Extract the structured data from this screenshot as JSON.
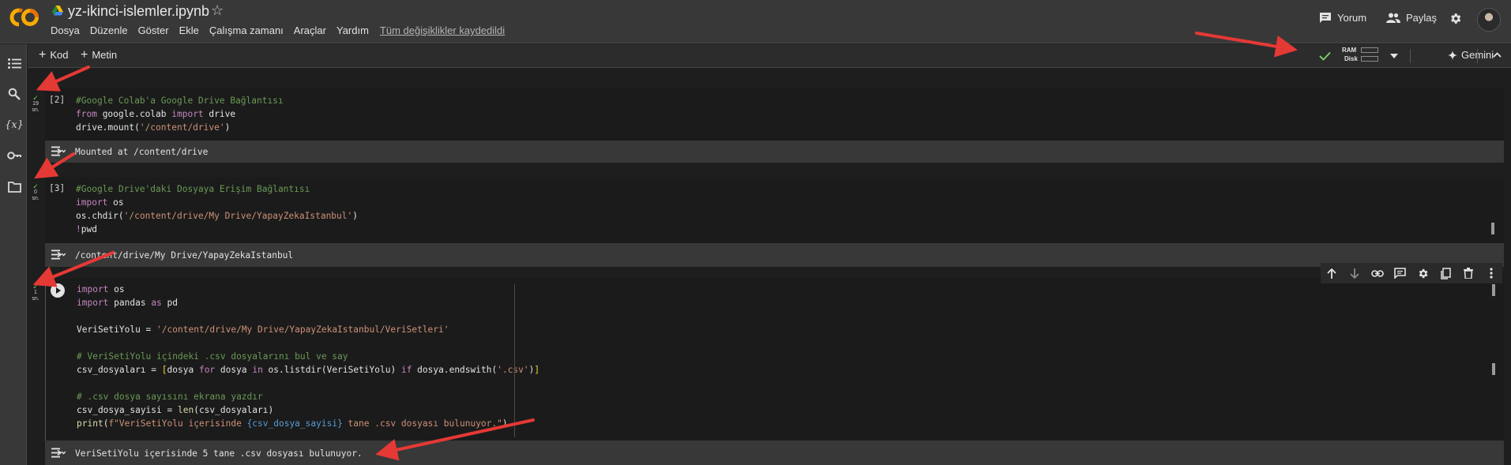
{
  "header": {
    "title": "yz-ikinci-islemler.ipynb",
    "menu": [
      "Dosya",
      "Düzenle",
      "Göster",
      "Ekle",
      "Çalışma zamanı",
      "Araçlar",
      "Yardım"
    ],
    "saved_status": "Tüm değişiklikler kaydedildi",
    "comment_label": "Yorum",
    "share_label": "Paylaş"
  },
  "toolbar": {
    "add_code": "Kod",
    "add_text": "Metin",
    "ram_label": "RAM",
    "disk_label": "Disk",
    "gemini_label": "Gemini"
  },
  "cells": [
    {
      "exec": "[2]",
      "status": {
        "time": "19",
        "unit": "sn."
      },
      "lines": [
        [
          {
            "c": "c-com",
            "t": "#Google Colab'a Google Drive Bağlantısı"
          }
        ],
        [
          {
            "c": "c-kw",
            "t": "from"
          },
          {
            "c": "c-def",
            "t": " google.colab "
          },
          {
            "c": "c-kw",
            "t": "import"
          },
          {
            "c": "c-def",
            "t": " drive"
          }
        ],
        [
          {
            "c": "c-def",
            "t": "drive.mount("
          },
          {
            "c": "c-str",
            "t": "'/content/drive'"
          },
          {
            "c": "c-def",
            "t": ")"
          }
        ]
      ],
      "output": "Mounted at /content/drive"
    },
    {
      "exec": "[3]",
      "status": {
        "time": "0",
        "unit": "sn."
      },
      "lines": [
        [
          {
            "c": "c-com",
            "t": "#Google Drive'daki Dosyaya Erişim Bağlantısı"
          }
        ],
        [
          {
            "c": "c-kw",
            "t": "import"
          },
          {
            "c": "c-def",
            "t": " os"
          }
        ],
        [
          {
            "c": "c-def",
            "t": "os.chdir("
          },
          {
            "c": "c-str",
            "t": "'/content/drive/My Drive/YapayZekaIstanbul'"
          },
          {
            "c": "c-def",
            "t": ")"
          }
        ],
        [
          {
            "c": "c-kw",
            "t": "!"
          },
          {
            "c": "c-def",
            "t": "pwd"
          }
        ]
      ],
      "output": "/content/drive/My Drive/YapayZekaIstanbul"
    },
    {
      "exec": "",
      "status": {
        "time": "1",
        "unit": "sn."
      },
      "lines": [
        [
          {
            "c": "c-kw",
            "t": "import"
          },
          {
            "c": "c-def",
            "t": " os"
          }
        ],
        [
          {
            "c": "c-kw",
            "t": "import"
          },
          {
            "c": "c-def",
            "t": " pandas "
          },
          {
            "c": "c-kw",
            "t": "as"
          },
          {
            "c": "c-def",
            "t": " pd"
          }
        ],
        [],
        [
          {
            "c": "c-def",
            "t": "VeriSetiYolu = "
          },
          {
            "c": "c-str",
            "t": "'/content/drive/My Drive/YapayZekaIstanbul/VeriSetleri'"
          }
        ],
        [],
        [
          {
            "c": "c-com",
            "t": "# VeriSetiYolu içindeki .csv dosyalarını bul ve say"
          }
        ],
        [
          {
            "c": "c-def",
            "t": "csv_dosyaları = "
          },
          {
            "c": "c-par",
            "t": "["
          },
          {
            "c": "c-def",
            "t": "dosya "
          },
          {
            "c": "c-kw",
            "t": "for"
          },
          {
            "c": "c-def",
            "t": " dosya "
          },
          {
            "c": "c-kw",
            "t": "in"
          },
          {
            "c": "c-def",
            "t": " os.listdir("
          },
          {
            "c": "c-def",
            "t": "VeriSetiYolu"
          },
          {
            "c": "c-def",
            "t": ") "
          },
          {
            "c": "c-kw",
            "t": "if"
          },
          {
            "c": "c-def",
            "t": " dosya.endswith("
          },
          {
            "c": "c-str",
            "t": "'.csv'"
          },
          {
            "c": "c-def",
            "t": ")"
          },
          {
            "c": "c-par",
            "t": "]"
          }
        ],
        [],
        [
          {
            "c": "c-com",
            "t": "# .csv dosya sayısını ekrana yazdır"
          }
        ],
        [
          {
            "c": "c-def",
            "t": "csv_dosya_sayisi = "
          },
          {
            "c": "c-fn",
            "t": "len"
          },
          {
            "c": "c-def",
            "t": "(csv_dosyaları)"
          }
        ],
        [
          {
            "c": "c-fn",
            "t": "print"
          },
          {
            "c": "c-def",
            "t": "("
          },
          {
            "c": "c-str",
            "t": "f\"VeriSetiYolu içerisinde "
          },
          {
            "c": "c-bl",
            "t": "{csv_dosya_sayisi}"
          },
          {
            "c": "c-str",
            "t": " tane .csv dosyası bulunuyor.\""
          },
          {
            "c": "c-def",
            "t": ")"
          }
        ]
      ],
      "output": "VeriSetiYolu içerisinde 5 tane .csv dosyası bulunuyor."
    }
  ],
  "icons": {
    "rail": [
      "table-of-contents-icon",
      "search-icon",
      "variables-icon",
      "secrets-key-icon",
      "files-folder-icon"
    ],
    "cell_toolbar": [
      "move-up-icon",
      "move-down-icon",
      "link-icon",
      "comment-icon",
      "settings-icon",
      "mirror-cell-icon",
      "delete-icon",
      "more-icon"
    ]
  },
  "colors": {
    "accent_orange": "#f9ab00",
    "success_green": "#7cc96b",
    "annotation_red": "#e53935"
  }
}
